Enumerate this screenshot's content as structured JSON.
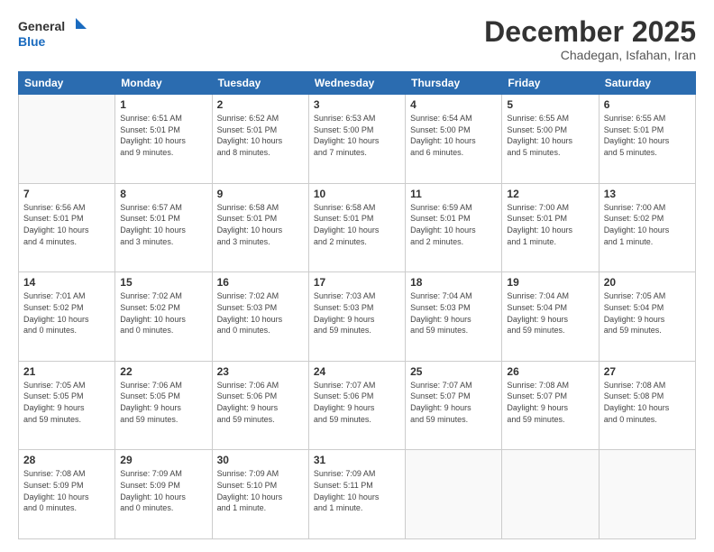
{
  "header": {
    "logo_line1": "General",
    "logo_line2": "Blue",
    "month": "December 2025",
    "location": "Chadegan, Isfahan, Iran"
  },
  "weekdays": [
    "Sunday",
    "Monday",
    "Tuesday",
    "Wednesday",
    "Thursday",
    "Friday",
    "Saturday"
  ],
  "weeks": [
    [
      {
        "day": "",
        "info": ""
      },
      {
        "day": "1",
        "info": "Sunrise: 6:51 AM\nSunset: 5:01 PM\nDaylight: 10 hours\nand 9 minutes."
      },
      {
        "day": "2",
        "info": "Sunrise: 6:52 AM\nSunset: 5:01 PM\nDaylight: 10 hours\nand 8 minutes."
      },
      {
        "day": "3",
        "info": "Sunrise: 6:53 AM\nSunset: 5:00 PM\nDaylight: 10 hours\nand 7 minutes."
      },
      {
        "day": "4",
        "info": "Sunrise: 6:54 AM\nSunset: 5:00 PM\nDaylight: 10 hours\nand 6 minutes."
      },
      {
        "day": "5",
        "info": "Sunrise: 6:55 AM\nSunset: 5:00 PM\nDaylight: 10 hours\nand 5 minutes."
      },
      {
        "day": "6",
        "info": "Sunrise: 6:55 AM\nSunset: 5:01 PM\nDaylight: 10 hours\nand 5 minutes."
      }
    ],
    [
      {
        "day": "7",
        "info": "Sunrise: 6:56 AM\nSunset: 5:01 PM\nDaylight: 10 hours\nand 4 minutes."
      },
      {
        "day": "8",
        "info": "Sunrise: 6:57 AM\nSunset: 5:01 PM\nDaylight: 10 hours\nand 3 minutes."
      },
      {
        "day": "9",
        "info": "Sunrise: 6:58 AM\nSunset: 5:01 PM\nDaylight: 10 hours\nand 3 minutes."
      },
      {
        "day": "10",
        "info": "Sunrise: 6:58 AM\nSunset: 5:01 PM\nDaylight: 10 hours\nand 2 minutes."
      },
      {
        "day": "11",
        "info": "Sunrise: 6:59 AM\nSunset: 5:01 PM\nDaylight: 10 hours\nand 2 minutes."
      },
      {
        "day": "12",
        "info": "Sunrise: 7:00 AM\nSunset: 5:01 PM\nDaylight: 10 hours\nand 1 minute."
      },
      {
        "day": "13",
        "info": "Sunrise: 7:00 AM\nSunset: 5:02 PM\nDaylight: 10 hours\nand 1 minute."
      }
    ],
    [
      {
        "day": "14",
        "info": "Sunrise: 7:01 AM\nSunset: 5:02 PM\nDaylight: 10 hours\nand 0 minutes."
      },
      {
        "day": "15",
        "info": "Sunrise: 7:02 AM\nSunset: 5:02 PM\nDaylight: 10 hours\nand 0 minutes."
      },
      {
        "day": "16",
        "info": "Sunrise: 7:02 AM\nSunset: 5:03 PM\nDaylight: 10 hours\nand 0 minutes."
      },
      {
        "day": "17",
        "info": "Sunrise: 7:03 AM\nSunset: 5:03 PM\nDaylight: 9 hours\nand 59 minutes."
      },
      {
        "day": "18",
        "info": "Sunrise: 7:04 AM\nSunset: 5:03 PM\nDaylight: 9 hours\nand 59 minutes."
      },
      {
        "day": "19",
        "info": "Sunrise: 7:04 AM\nSunset: 5:04 PM\nDaylight: 9 hours\nand 59 minutes."
      },
      {
        "day": "20",
        "info": "Sunrise: 7:05 AM\nSunset: 5:04 PM\nDaylight: 9 hours\nand 59 minutes."
      }
    ],
    [
      {
        "day": "21",
        "info": "Sunrise: 7:05 AM\nSunset: 5:05 PM\nDaylight: 9 hours\nand 59 minutes."
      },
      {
        "day": "22",
        "info": "Sunrise: 7:06 AM\nSunset: 5:05 PM\nDaylight: 9 hours\nand 59 minutes."
      },
      {
        "day": "23",
        "info": "Sunrise: 7:06 AM\nSunset: 5:06 PM\nDaylight: 9 hours\nand 59 minutes."
      },
      {
        "day": "24",
        "info": "Sunrise: 7:07 AM\nSunset: 5:06 PM\nDaylight: 9 hours\nand 59 minutes."
      },
      {
        "day": "25",
        "info": "Sunrise: 7:07 AM\nSunset: 5:07 PM\nDaylight: 9 hours\nand 59 minutes."
      },
      {
        "day": "26",
        "info": "Sunrise: 7:08 AM\nSunset: 5:07 PM\nDaylight: 9 hours\nand 59 minutes."
      },
      {
        "day": "27",
        "info": "Sunrise: 7:08 AM\nSunset: 5:08 PM\nDaylight: 10 hours\nand 0 minutes."
      }
    ],
    [
      {
        "day": "28",
        "info": "Sunrise: 7:08 AM\nSunset: 5:09 PM\nDaylight: 10 hours\nand 0 minutes."
      },
      {
        "day": "29",
        "info": "Sunrise: 7:09 AM\nSunset: 5:09 PM\nDaylight: 10 hours\nand 0 minutes."
      },
      {
        "day": "30",
        "info": "Sunrise: 7:09 AM\nSunset: 5:10 PM\nDaylight: 10 hours\nand 1 minute."
      },
      {
        "day": "31",
        "info": "Sunrise: 7:09 AM\nSunset: 5:11 PM\nDaylight: 10 hours\nand 1 minute."
      },
      {
        "day": "",
        "info": ""
      },
      {
        "day": "",
        "info": ""
      },
      {
        "day": "",
        "info": ""
      }
    ]
  ]
}
